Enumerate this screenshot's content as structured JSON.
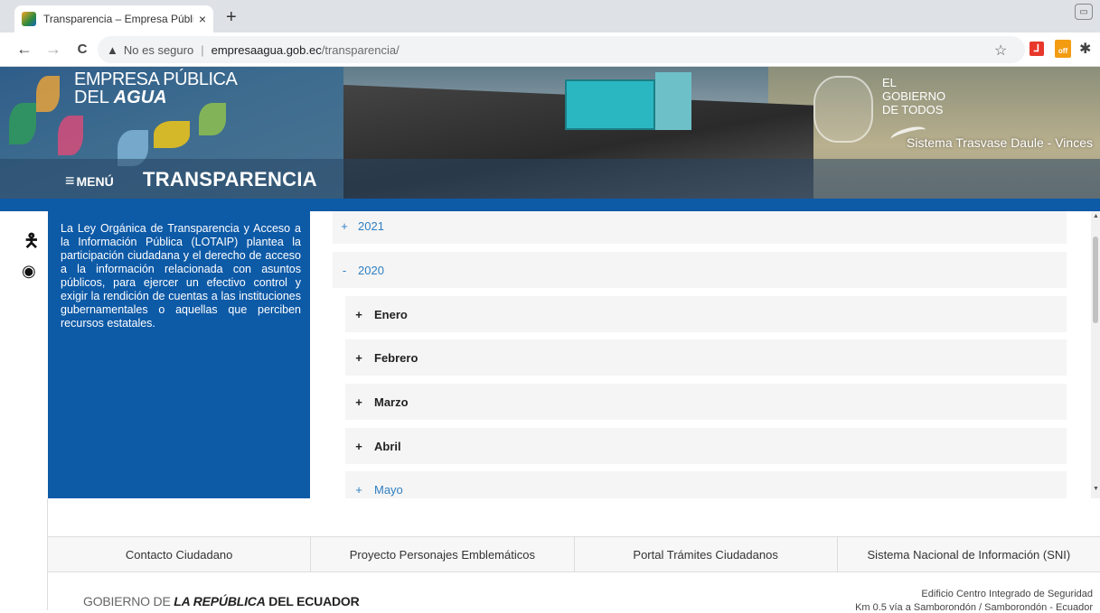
{
  "browser": {
    "tab_title": "Transparencia – Empresa Pública",
    "tab_close": "×",
    "new_tab": "+",
    "nav": {
      "back": "←",
      "forward": "→",
      "reload": "C"
    },
    "security_warning": "No es seguro",
    "url_host": "empresaagua.gob.ec",
    "url_path": "/transparencia/",
    "bookmark": "☆"
  },
  "header": {
    "brand_line1": "EMPRESA PÚBLICA",
    "brand_line2_prefix": "DEL ",
    "brand_line2_bold": "AGUA",
    "gov_line1": "EL",
    "gov_line2": "GOBIERNO",
    "gov_line3": "DE TODOS",
    "system_name": "Sistema Trasvase Daule - Vinces",
    "menu_label": "MENÚ",
    "page_title": "TRANSPARENCIA"
  },
  "intro_text": "La Ley Orgánica de Transparencia y Acceso a la Información Pública (LOTAIP) plantea la participación ciudadana y el derecho de acceso a la información relacionada con asuntos públicos, para ejercer un efectivo control y exigir la rendición de cuentas a las instituciones gubernamentales o aquellas que perciben recursos estatales.",
  "accordion": {
    "years": [
      {
        "sign": "+",
        "label": "2021"
      },
      {
        "sign": "-",
        "label": "2020"
      }
    ],
    "months": [
      {
        "sign": "+",
        "label": "Enero"
      },
      {
        "sign": "+",
        "label": "Febrero"
      },
      {
        "sign": "+",
        "label": "Marzo"
      },
      {
        "sign": "+",
        "label": "Abril"
      },
      {
        "sign": "+",
        "label": "Mayo"
      }
    ]
  },
  "footer": {
    "links": [
      "Contacto Ciudadano",
      "Proyecto Personajes Emblemáticos",
      "Portal Trámites Ciudadanos",
      "Sistema Nacional de Información (SNI)"
    ],
    "gov_prefix": "GOBIERNO DE ",
    "gov_bold": "LA REPÚBLICA",
    "gov_suffix": " DEL ECUADOR",
    "address_line1": "Edificio Centro Integrado de Seguridad",
    "address_line2": "Km 0.5 vía a Samborondón / Samborondón - Ecuador"
  },
  "colors": {
    "primary_blue": "#0d5aa7",
    "link_blue": "#2f7fc1"
  }
}
